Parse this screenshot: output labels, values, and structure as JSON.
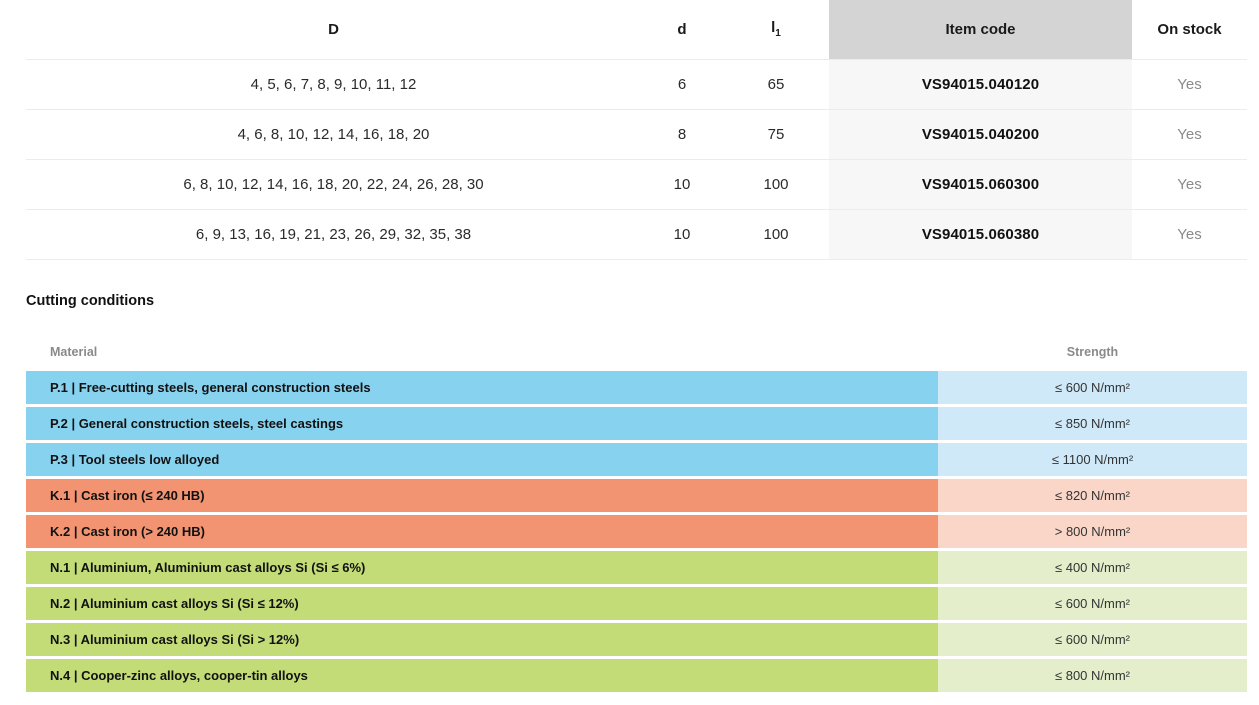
{
  "dimensions_table": {
    "headers": {
      "d_outer": "D",
      "d_inner": "d",
      "l1_main": "l",
      "l1_sub": "1",
      "item_code": "Item code",
      "on_stock": "On stock"
    },
    "rows": [
      {
        "D": "4, 5, 6, 7, 8, 9, 10, 11, 12",
        "d": "6",
        "l1": "65",
        "item_code": "VS94015.040120",
        "on_stock": "Yes"
      },
      {
        "D": "4, 6, 8, 10, 12, 14, 16, 18, 20",
        "d": "8",
        "l1": "75",
        "item_code": "VS94015.040200",
        "on_stock": "Yes"
      },
      {
        "D": "6, 8, 10, 12, 14, 16, 18, 20, 22, 24, 26, 28, 30",
        "d": "10",
        "l1": "100",
        "item_code": "VS94015.060300",
        "on_stock": "Yes"
      },
      {
        "D": "6, 9, 13, 16, 19, 21, 23, 26, 29, 32, 35, 38",
        "d": "10",
        "l1": "100",
        "item_code": "VS94015.060380",
        "on_stock": "Yes"
      }
    ]
  },
  "cutting_conditions": {
    "title": "Cutting conditions",
    "headers": {
      "material": "Material",
      "strength": "Strength"
    },
    "rows": [
      {
        "material": "P.1 | Free-cutting steels, general construction steels",
        "strength": "≤ 600 N/mm²",
        "group": "P"
      },
      {
        "material": "P.2 | General construction steels, steel castings",
        "strength": "≤ 850 N/mm²",
        "group": "P"
      },
      {
        "material": "P.3 | Tool steels low alloyed",
        "strength": "≤ 1100 N/mm²",
        "group": "P"
      },
      {
        "material": "K.1 | Cast iron (≤ 240 HB)",
        "strength": "≤ 820 N/mm²",
        "group": "K"
      },
      {
        "material": "K.2 | Cast iron (> 240 HB)",
        "strength": "> 800 N/mm²",
        "group": "K"
      },
      {
        "material": "N.1 | Aluminium, Aluminium cast alloys Si (Si ≤ 6%)",
        "strength": "≤ 400 N/mm²",
        "group": "N"
      },
      {
        "material": "N.2 | Aluminium cast alloys Si (Si ≤ 12%)",
        "strength": "≤ 600 N/mm²",
        "group": "N"
      },
      {
        "material": "N.3 | Aluminium cast alloys Si (Si > 12%)",
        "strength": "≤ 600 N/mm²",
        "group": "N"
      },
      {
        "material": "N.4 | Cooper-zinc alloys, cooper-tin alloys",
        "strength": "≤ 800 N/mm²",
        "group": "N"
      }
    ],
    "group_colors": {
      "P": {
        "material_bg": "#87d3ef",
        "strength_bg": "#cfe9f9"
      },
      "K": {
        "material_bg": "#f29472",
        "strength_bg": "#fad6c9"
      },
      "N": {
        "material_bg": "#c3dc77",
        "strength_bg": "#e4eecb"
      }
    }
  },
  "style_colors": {
    "item_code_header_bg": "#d4d4d4",
    "item_code_cell_bg": "#f7f7f7",
    "row_divider": "#ececec",
    "muted_text": "#8a8a8a"
  }
}
